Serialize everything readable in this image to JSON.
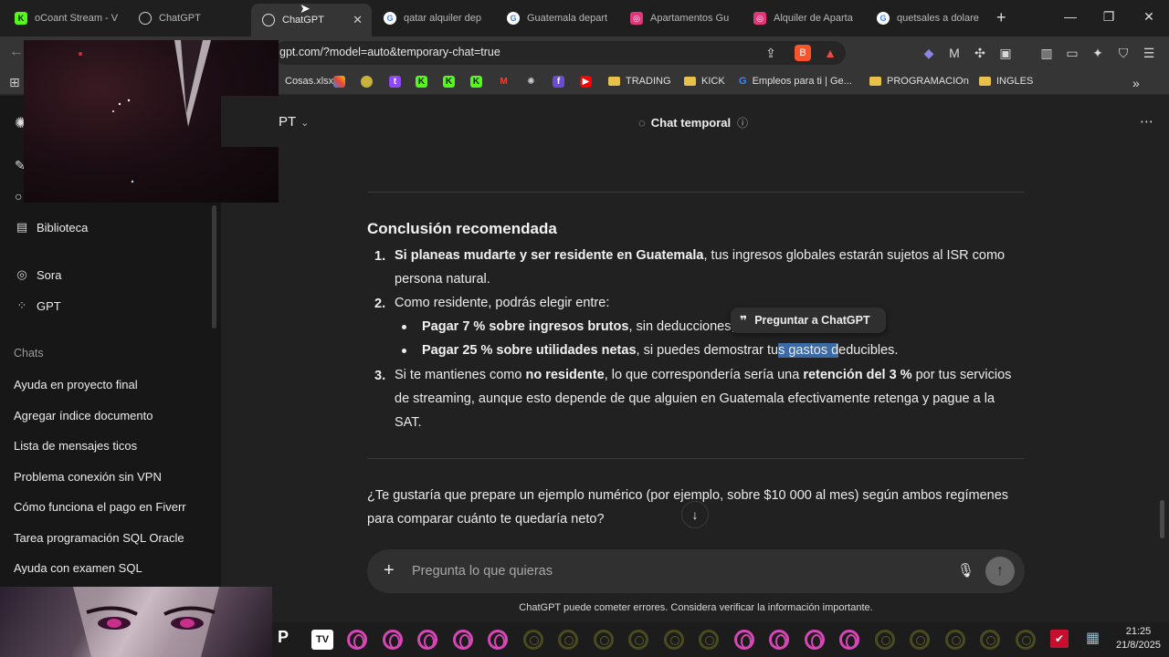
{
  "browser": {
    "tabs": [
      {
        "label": "oCoant Stream - V",
        "favicon": "K"
      },
      {
        "label": "ChatGPT",
        "favicon": "gpt"
      },
      {
        "label": "ChatGPT",
        "favicon": "gpt",
        "active": true
      },
      {
        "label": "qatar alquiler dep",
        "favicon": "G"
      },
      {
        "label": "Guatemala depart",
        "favicon": "G"
      },
      {
        "label": "Apartamentos Gu",
        "favicon": "A"
      },
      {
        "label": "Alquiler de Aparta",
        "favicon": "A"
      },
      {
        "label": "quetsales a dolare",
        "favicon": "G"
      }
    ],
    "new_tab": "+",
    "url": "gpt.com/?model=auto&temporary-chat=true",
    "bookmarks": [
      {
        "label": "Cosas.xlsx",
        "type": "file"
      },
      {
        "label": "TRADING",
        "type": "folder"
      },
      {
        "label": "KICK",
        "type": "folder"
      },
      {
        "label": "Empleos para ti | Ge...",
        "type": "link"
      },
      {
        "label": "PROGRAMACIOn",
        "type": "folder"
      },
      {
        "label": "INGLES",
        "type": "folder"
      }
    ],
    "more_bookmarks": "»"
  },
  "sidebar": {
    "nav": [
      {
        "label": "Biblioteca",
        "icon": "library-icon"
      },
      {
        "label": "Sora",
        "icon": "sora-icon"
      },
      {
        "label": "GPT",
        "icon": "grid-icon"
      }
    ],
    "section_label": "Chats",
    "chats": [
      "Ayuda en proyecto final",
      "Agregar índice documento",
      "Lista de mensajes ticos",
      "Problema conexión sin VPN",
      "Cómo funciona el pago en Fiverr",
      "Tarea programación SQL Oracle",
      "Ayuda con examen SQL"
    ]
  },
  "header": {
    "model": "PT",
    "title": "Chat temporal"
  },
  "message": {
    "heading": "Conclusión recomendada",
    "item1_bold": "Si planeas mudarte y ser residente en Guatemala",
    "item1_rest": ", tus ingresos globales estarán sujetos al ISR como",
    "item1_line2": "persona natural.",
    "item2_line1": "Como residente, podrás elegir entre:",
    "sub1_bold": "Pagar 7 % sobre ingresos brutos",
    "sub1_rest": ", sin deducciones;",
    "sub2_bold": "Pagar 25 % sobre utilidades netas",
    "sub2_pre": ", si puedes demostrar tu",
    "sub2_sel": "s gastos d",
    "sub2_post": "educibles.",
    "item3_pre": "Si te mantienes como ",
    "item3_b1": "no residente",
    "item3_mid": ", lo que correspondería sería una ",
    "item3_b2": "retención del 3 %",
    "item3_post": " por tus servicios",
    "item3_line2": "de streaming, aunque esto depende de que alguien en Guatemala efectivamente retenga y pague a la",
    "item3_line3": "SAT.",
    "question_line1": "¿Te gustaría que prepare un ejemplo numérico (por ejemplo, sobre $10 000 al mes) según ambos regímenes",
    "question_line2": "para comparar cuánto te quedaría neto?",
    "n1": "1.",
    "n2": "2.",
    "n3": "3."
  },
  "tooltip": {
    "label": "Preguntar a ChatGPT"
  },
  "composer": {
    "placeholder": "Pregunta lo que quieras"
  },
  "disclaimer": "ChatGPT puede cometer errores. Considera verificar la información importante.",
  "taskbar": {
    "time": "21:25",
    "date": "21/8/2025"
  }
}
